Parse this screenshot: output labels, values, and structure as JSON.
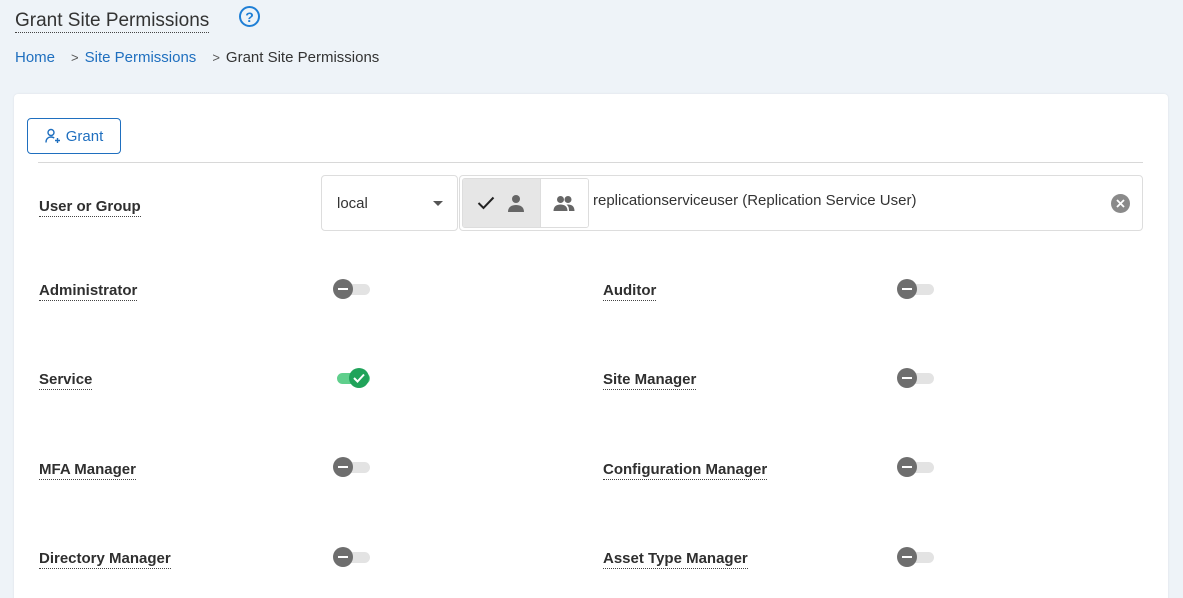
{
  "header": {
    "title": "Grant Site Permissions",
    "help_icon": "question-circle-icon"
  },
  "breadcrumb": {
    "home": "Home",
    "site_permissions": "Site Permissions",
    "current": "Grant Site Permissions",
    "separator": ">"
  },
  "toolbar": {
    "grant_label": "Grant",
    "grant_icon": "add-user-icon"
  },
  "user_or_group": {
    "label": "User or Group",
    "directory_value": "local",
    "selected_type": "user",
    "value": "replicationserviceuser (Replication Service User)"
  },
  "permissions": [
    {
      "label": "Administrator",
      "enabled": false
    },
    {
      "label": "Auditor",
      "enabled": false
    },
    {
      "label": "Service",
      "enabled": true
    },
    {
      "label": "Site Manager",
      "enabled": false
    },
    {
      "label": "MFA Manager",
      "enabled": false
    },
    {
      "label": "Configuration Manager",
      "enabled": false
    },
    {
      "label": "Directory Manager",
      "enabled": false
    },
    {
      "label": "Asset Type Manager",
      "enabled": false
    }
  ],
  "colors": {
    "accent": "#1f6fbf",
    "toggle_on": "#20a35a",
    "toggle_off": "#6e6e6e"
  }
}
